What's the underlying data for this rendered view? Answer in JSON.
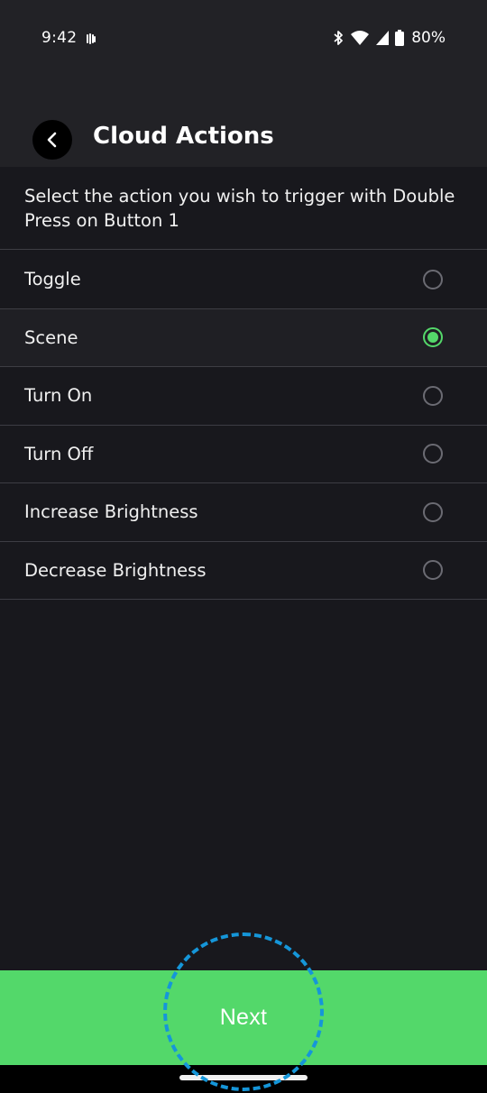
{
  "status_bar": {
    "time": "9:42",
    "battery": "80%",
    "icons": [
      "notification-icon",
      "bluetooth-icon",
      "wifi-icon",
      "signal-icon",
      "battery-icon"
    ]
  },
  "header": {
    "title": "Cloud Actions",
    "back_icon": "chevron-left-icon"
  },
  "description": "Select the action you wish to trigger with Double Press on Button 1",
  "options": [
    {
      "label": "Toggle",
      "selected": false
    },
    {
      "label": "Scene",
      "selected": true
    },
    {
      "label": "Turn On",
      "selected": false
    },
    {
      "label": "Turn Off",
      "selected": false
    },
    {
      "label": "Increase Brightness",
      "selected": false
    },
    {
      "label": "Decrease Brightness",
      "selected": false
    }
  ],
  "footer": {
    "next_label": "Next"
  },
  "colors": {
    "accent": "#53d86a",
    "background": "#18181d",
    "header": "#222226",
    "tap_indicator": "#1596d9"
  }
}
